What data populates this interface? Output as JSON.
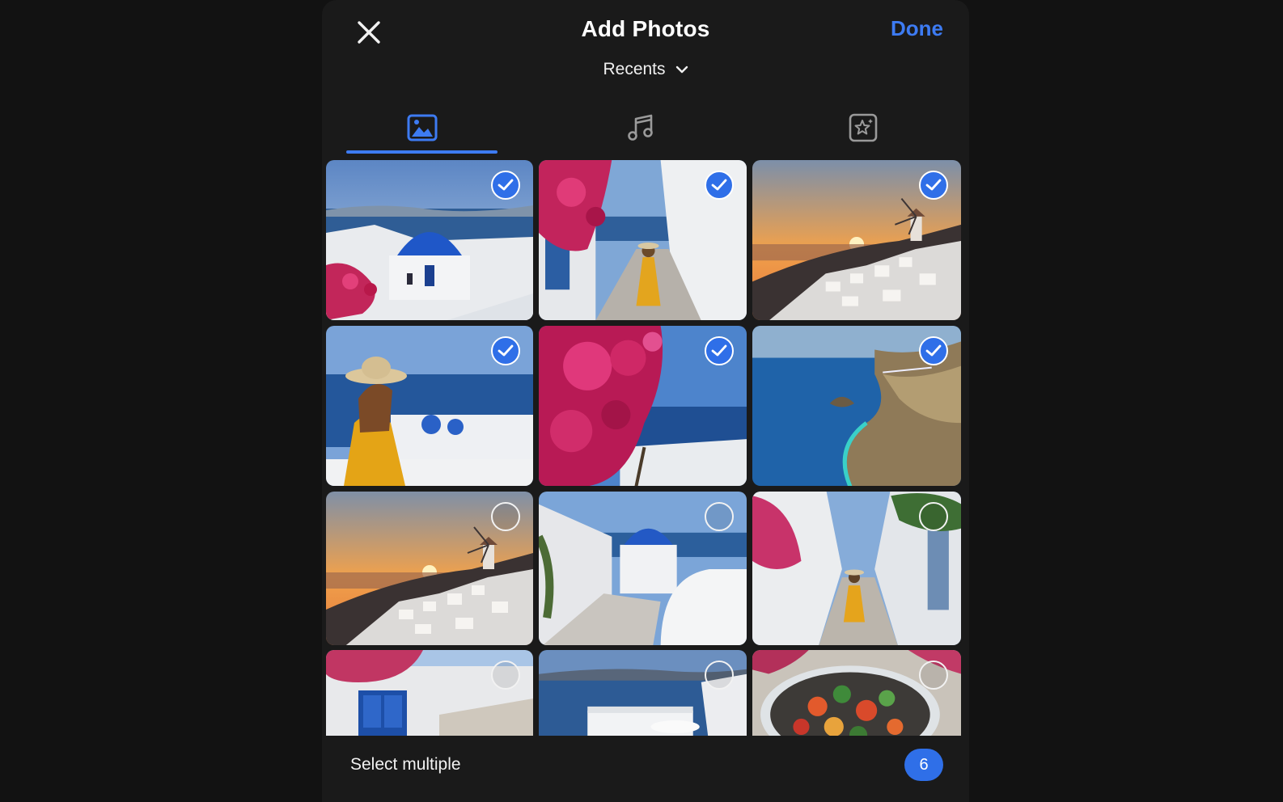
{
  "header": {
    "title": "Add Photos",
    "done_label": "Done",
    "album_label": "Recents"
  },
  "tabs": [
    {
      "icon": "photo-icon",
      "active": true
    },
    {
      "icon": "music-note-icon",
      "active": false
    },
    {
      "icon": "sparkle-frame-icon",
      "active": false
    }
  ],
  "photos": [
    {
      "scene": "blue-dome-church",
      "selected": true
    },
    {
      "scene": "woman-alley-bougainvillea",
      "selected": true
    },
    {
      "scene": "sunset-windmill-village",
      "selected": true
    },
    {
      "scene": "woman-hat-sea-view",
      "selected": true
    },
    {
      "scene": "bougainvillea-sea",
      "selected": true
    },
    {
      "scene": "aerial-coastline",
      "selected": true
    },
    {
      "scene": "sunset-windmill-village",
      "selected": false
    },
    {
      "scene": "blue-dome-stairs",
      "selected": false
    },
    {
      "scene": "woman-white-alley",
      "selected": false
    },
    {
      "scene": "blue-door-house",
      "selected": false
    },
    {
      "scene": "sea-terrace",
      "selected": false
    },
    {
      "scene": "food-platter",
      "selected": false
    }
  ],
  "footer": {
    "select_multiple_label": "Select multiple",
    "selected_count": "6"
  },
  "colors": {
    "accent": "#3d7bf2",
    "background": "#121212",
    "panel": "#1a1a1a"
  }
}
